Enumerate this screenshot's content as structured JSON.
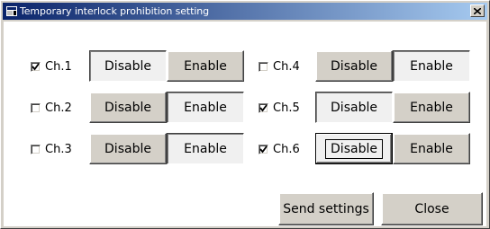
{
  "window": {
    "title": "Temporary interlock prohibition setting",
    "close_glyph": "×"
  },
  "channels": [
    {
      "label": "Ch.1",
      "checked": true,
      "state": "Disable"
    },
    {
      "label": "Ch.2",
      "checked": false,
      "state": "Enable"
    },
    {
      "label": "Ch.3",
      "checked": false,
      "state": "Enable"
    },
    {
      "label": "Ch.4",
      "checked": false,
      "state": "Enable"
    },
    {
      "label": "Ch.5",
      "checked": true,
      "state": "Disable"
    },
    {
      "label": "Ch.6",
      "checked": true,
      "state": "Disable"
    }
  ],
  "buttons": {
    "disable_label": "Disable",
    "enable_label": "Enable",
    "send_label": "Send settings",
    "close_label": "Close"
  },
  "colors": {
    "face": "#d4d0c8",
    "title_start": "#0a246a",
    "title_end": "#a6caf0"
  }
}
